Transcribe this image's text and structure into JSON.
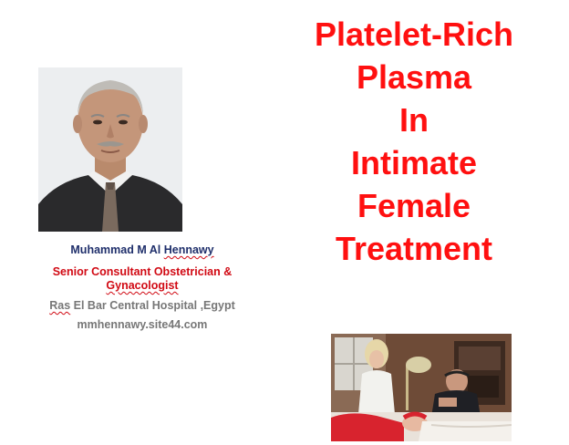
{
  "author": {
    "name_first": "Muhammad  M  Al ",
    "name_last": "Hennawy",
    "title_line1": "Senior Consultant Obstetrician &",
    "title_line2": "Gynacologist",
    "hospital_prefix": "Ras",
    "hospital_rest": " El Bar Central Hospital ,Egypt",
    "website": "mmhennawy.site44.com"
  },
  "title": {
    "lines": [
      "Platelet-Rich",
      "Plasma",
      "In",
      "Intimate",
      "Female",
      "Treatment"
    ]
  },
  "colors": {
    "title_red": "#ff1010",
    "subtitle_red": "#d10a14",
    "name_navy": "#1f2f6b",
    "gray_text": "#777777"
  }
}
